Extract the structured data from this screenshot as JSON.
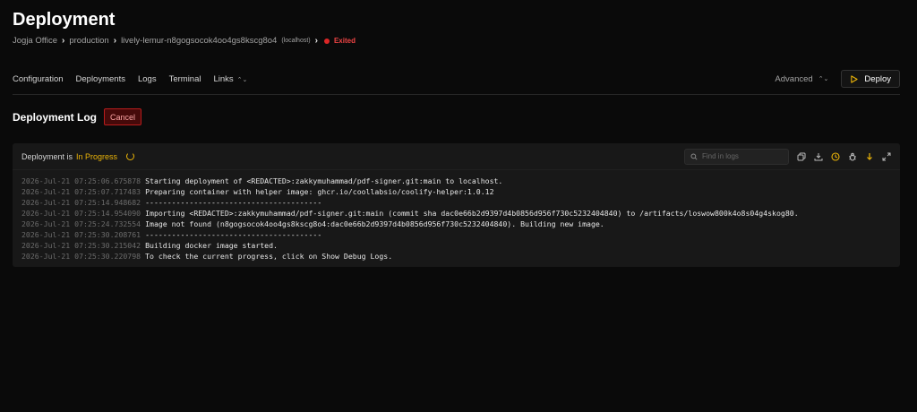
{
  "page": {
    "title": "Deployment"
  },
  "breadcrumb": {
    "items": [
      "Jogja Office",
      "production",
      "lively-lemur-n8gogsocok4oo4gs8kscg8o4"
    ],
    "host": "(localhost)",
    "status": "Exited",
    "status_color": "#ef4444"
  },
  "nav": {
    "items": [
      "Configuration",
      "Deployments",
      "Logs",
      "Terminal",
      "Links"
    ]
  },
  "actions": {
    "advanced_label": "Advanced",
    "deploy_label": "Deploy"
  },
  "deployment_log": {
    "title": "Deployment Log",
    "cancel_label": "Cancel",
    "status_prefix": "Deployment is",
    "status_value": "In Progress",
    "search_placeholder": "Find in logs",
    "accent_color": "#eab308",
    "lines": [
      {
        "ts": "2026-Jul-21 07:25:06.675878",
        "msg": "Starting deployment of <REDACTED>:zakkymuhammad/pdf-signer.git:main to localhost."
      },
      {
        "ts": "2026-Jul-21 07:25:07.717483",
        "msg": "Preparing container with helper image: ghcr.io/coollabsio/coolify-helper:1.0.12"
      },
      {
        "ts": "2026-Jul-21 07:25:14.948682",
        "msg": "----------------------------------------"
      },
      {
        "ts": "2026-Jul-21 07:25:14.954090",
        "msg": "Importing <REDACTED>:zakkymuhammad/pdf-signer.git:main (commit sha dac0e66b2d9397d4b0856d956f730c5232404840) to /artifacts/loswow800k4o8s04g4skog80."
      },
      {
        "ts": "2026-Jul-21 07:25:24.732554",
        "msg": "Image not found (n8gogsocok4oo4gs8kscg8o4:dac0e66b2d9397d4b0856d956f730c5232404840). Building new image."
      },
      {
        "ts": "2026-Jul-21 07:25:30.208761",
        "msg": "----------------------------------------"
      },
      {
        "ts": "2026-Jul-21 07:25:30.215042",
        "msg": "Building docker image started."
      },
      {
        "ts": "2026-Jul-21 07:25:30.220798",
        "msg": "To check the current progress, click on Show Debug Logs."
      }
    ]
  },
  "icons": [
    "search-icon",
    "copy-icon",
    "download-icon",
    "clock-icon",
    "debug-icon",
    "arrow-down-icon",
    "expand-icon",
    "play-icon",
    "chevron-updown-icon"
  ]
}
